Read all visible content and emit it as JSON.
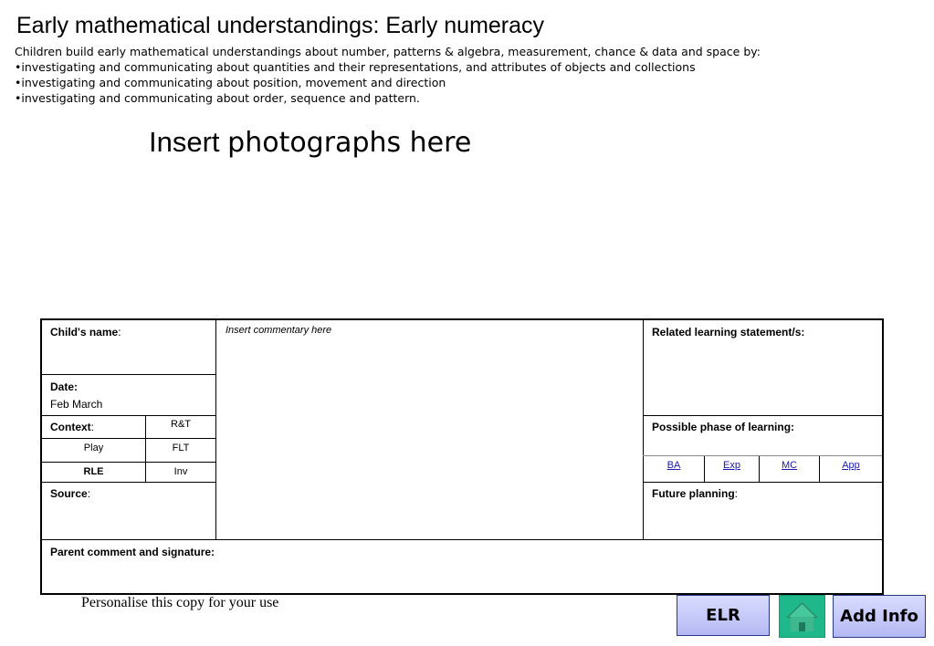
{
  "title": "Early mathematical understandings: Early numeracy",
  "intro": [
    "Children build early mathematical understandings about number, patterns & algebra, measurement, chance & data and space by:",
    "•investigating and communicating about quantities and their representations, and attributes of objects and collections",
    "•investigating and communicating about position, movement and direction",
    "•investigating and communicating about order, sequence and pattern."
  ],
  "photo_placeholder": {
    "word1": "Insert",
    "word2": "photographs here"
  },
  "form": {
    "child_name_label": "Child's name",
    "colon": ":",
    "date_label": "Date:",
    "date_value": "Feb March",
    "context_label": "Context",
    "context_options": {
      "rt": "R&T",
      "play": "Play",
      "flt": "FLT",
      "rle": "RLE",
      "inv": "Inv"
    },
    "source_label": "Source",
    "commentary_placeholder": "Insert commentary here",
    "related_label": "Related  learning statement/s:",
    "phase_label": "Possible phase of learning:",
    "phase_links": [
      "BA",
      "Exp",
      "MC",
      "App"
    ],
    "future_label": "Future planning",
    "parent_label": "Parent comment and signature:"
  },
  "footer": {
    "personalise": "Personalise this copy for your use",
    "elr_button": "ELR",
    "add_info_button": "Add Info"
  },
  "colors": {
    "nav_button_bg": "#c6caf8",
    "home_button_bg": "#1fb88a",
    "link": "#1a1aaa"
  }
}
